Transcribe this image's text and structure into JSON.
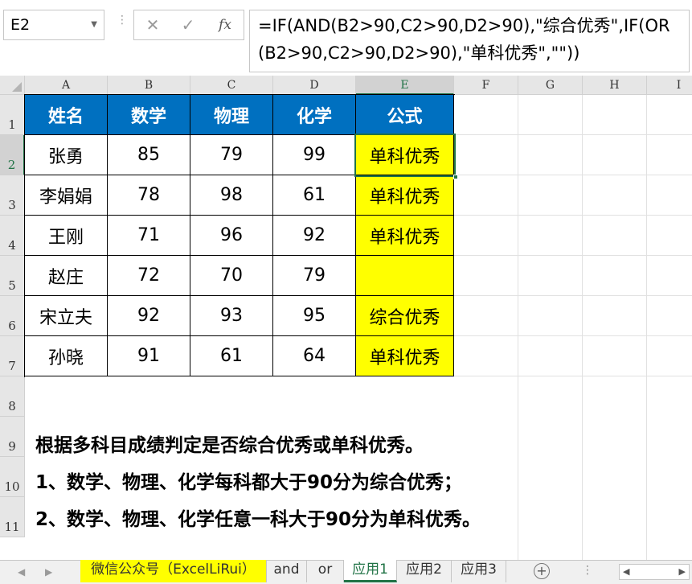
{
  "formula_bar": {
    "name_box": "E2",
    "cancel_icon": "✕",
    "enter_icon": "✓",
    "fx_label": "fx",
    "formula": "=IF(AND(B2>90,C2>90,D2>90),\"综合优秀\",IF(OR(B2>90,C2>90,D2>90),\"单科优秀\",\"\"))"
  },
  "columns": [
    "A",
    "B",
    "C",
    "D",
    "E",
    "F",
    "G",
    "H",
    "I"
  ],
  "rows": [
    "1",
    "2",
    "3",
    "4",
    "5",
    "6",
    "7",
    "8",
    "9",
    "10",
    "11"
  ],
  "active_cell": "E2",
  "table": {
    "headers": [
      "姓名",
      "数学",
      "物理",
      "化学",
      "公式"
    ],
    "rows": [
      [
        "张勇",
        "85",
        "79",
        "99",
        "单科优秀"
      ],
      [
        "李娟娟",
        "78",
        "98",
        "61",
        "单科优秀"
      ],
      [
        "王刚",
        "71",
        "96",
        "92",
        "单科优秀"
      ],
      [
        "赵庄",
        "72",
        "70",
        "79",
        ""
      ],
      [
        "宋立夫",
        "92",
        "93",
        "95",
        "综合优秀"
      ],
      [
        "孙晓",
        "91",
        "61",
        "64",
        "单科优秀"
      ]
    ]
  },
  "notes": [
    "根据多科目成绩判定是否综合优秀或单科优秀。",
    "1、数学、物理、化学每科都大于90分为综合优秀；",
    "2、数学、物理、化学任意一科大于90分为单科优秀。"
  ],
  "sheet_tabs": [
    {
      "label": "微信公众号（ExcelLiRui）",
      "style": "wechat"
    },
    {
      "label": "and",
      "style": "normal"
    },
    {
      "label": "or",
      "style": "normal"
    },
    {
      "label": "应用1",
      "style": "active"
    },
    {
      "label": "应用2",
      "style": "normal"
    },
    {
      "label": "应用3",
      "style": "normal"
    }
  ],
  "add_sheet_label": "+",
  "tab_overflow_label": "⋮",
  "colors": {
    "header_fill": "#0070c0",
    "highlight_fill": "#ffff00",
    "excel_green": "#217346"
  },
  "icons": {
    "name_box_dropdown": "chevron-down-icon",
    "cancel": "close-icon",
    "enter": "check-icon",
    "function": "fx-icon",
    "tab_nav_prev": "chevron-left-icon",
    "tab_nav_next": "chevron-right-icon",
    "add_sheet": "plus-circle-icon"
  }
}
